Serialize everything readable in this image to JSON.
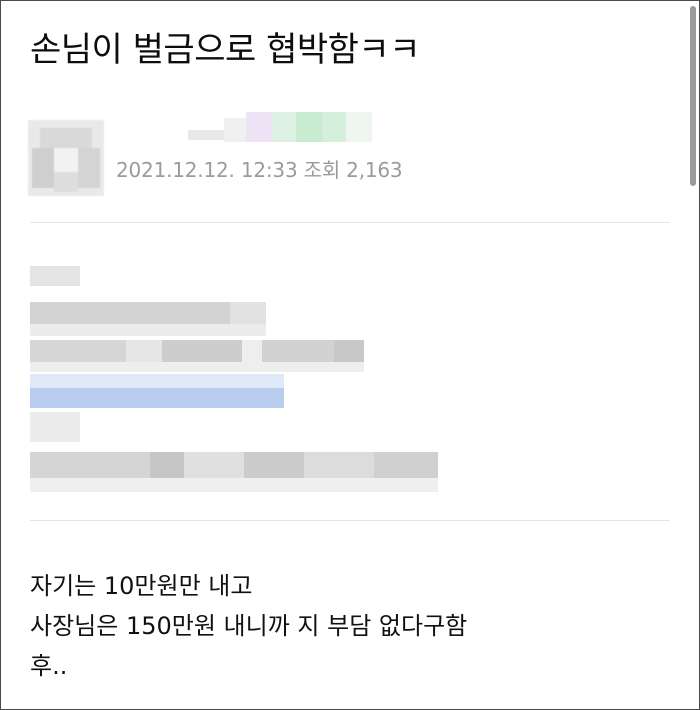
{
  "post": {
    "title": "손님이 벌금으로 협박함ㅋㅋ",
    "meta": "2021.12.12. 12:33 조회 2,163",
    "lines": [
      "자기는 10만원만 내고",
      "사장님은 150만원 내니까 지 부담 없다구함",
      "후.."
    ]
  },
  "pixelation": {
    "colors": {
      "light": "#ececec",
      "mid": "#d8d8d8",
      "dark": "#c4c4c4",
      "blue_light": "#dfe9f8",
      "blue": "#b8cdee",
      "green": "#c9ebd1",
      "lavender": "#ebe2f5"
    }
  }
}
